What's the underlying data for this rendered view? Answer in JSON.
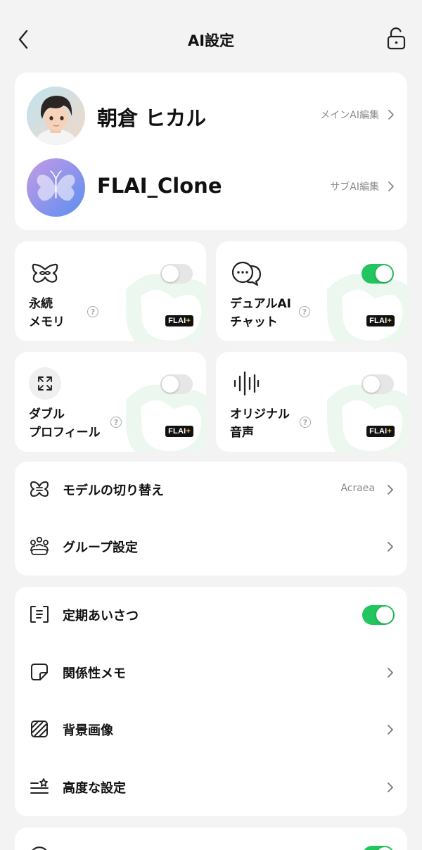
{
  "header": {
    "title": "AI設定"
  },
  "profiles": [
    {
      "name": "朝倉 ヒカル",
      "edit_label": "メインAI編集"
    },
    {
      "name": "FLAI_Clone",
      "edit_label": "サブAI編集"
    }
  ],
  "features": [
    {
      "label_line1": "永続",
      "label_line2": "メモリ",
      "enabled": false,
      "badge": "FLAI",
      "badge_plus": "+"
    },
    {
      "label_line1": "デュアルAI",
      "label_line2": "チャット",
      "enabled": true,
      "badge": "FLAI",
      "badge_plus": "+"
    },
    {
      "label_line1": "ダブル",
      "label_line2": "プロフィール",
      "enabled": false,
      "badge": "FLAI",
      "badge_plus": "+"
    },
    {
      "label_line1": "オリジナル",
      "label_line2": "音声",
      "enabled": false,
      "badge": "FLAI",
      "badge_plus": "+"
    }
  ],
  "help_mark": "?",
  "model_group": {
    "model_switch": {
      "label": "モデルの切り替え",
      "value": "Acraea"
    },
    "group_settings": {
      "label": "グループ設定"
    }
  },
  "settings_group": {
    "greeting": {
      "label": "定期あいさつ",
      "enabled": true
    },
    "relationship_memo": {
      "label": "関係性メモ"
    },
    "background_image": {
      "label": "背景画像"
    },
    "advanced": {
      "label": "高度な設定"
    }
  },
  "colors": {
    "accent": "#22c55e",
    "background": "#f3f3f3",
    "card": "#ffffff",
    "muted": "#8a8a8a"
  },
  "icons": [
    "back-arrow-icon",
    "unlock-icon",
    "butterfly-avatar-icon",
    "infinity-memory-icon",
    "chat-bubbles-icon",
    "expand-icon",
    "sound-wave-icon",
    "model-icon",
    "group-icon",
    "greeting-icon",
    "memo-icon",
    "background-image-icon",
    "advanced-settings-icon",
    "chevron-right-icon"
  ]
}
